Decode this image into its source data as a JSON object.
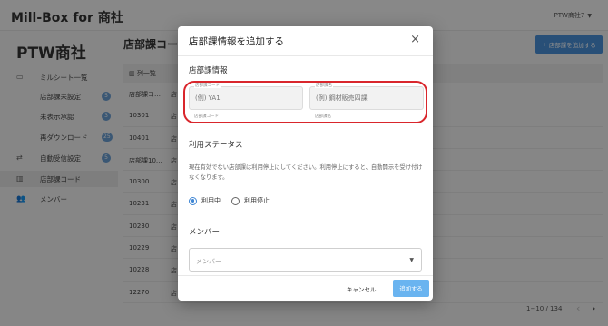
{
  "app": {
    "title": "Mill-Box for 商社",
    "user_menu": "PTW商社7"
  },
  "sidebar": {
    "company": "PTW商社",
    "items": [
      {
        "label": "ミルシート一覧",
        "icon": "inbox-icon"
      },
      {
        "label": "店部課未設定",
        "badge": "5"
      },
      {
        "label": "未表示承認",
        "badge": "3"
      },
      {
        "label": "再ダウンロード",
        "badge": "25"
      },
      {
        "label": "自動受信設定",
        "badge": "5",
        "icon": "sync-icon"
      },
      {
        "label": "店部課コード",
        "icon": "building-icon",
        "active": true
      },
      {
        "label": "メンバー",
        "icon": "people-icon"
      }
    ]
  },
  "main": {
    "title": "店部課コード",
    "add_button": "店部課を追加する",
    "column_toggle": "列一覧",
    "rows": [
      {
        "code": "店部課コ…",
        "name": "店"
      },
      {
        "code": "10301",
        "name": "店"
      },
      {
        "code": "10401",
        "name": "店"
      },
      {
        "code": "店部課10…",
        "name": "店"
      },
      {
        "code": "10300",
        "name": "店"
      },
      {
        "code": "10231",
        "name": "店"
      },
      {
        "code": "10230",
        "name": "店"
      },
      {
        "code": "10229",
        "name": "店"
      },
      {
        "code": "10228",
        "name": "店"
      },
      {
        "code": "12270",
        "name": "店"
      }
    ],
    "pager": "1−10 / 134"
  },
  "dialog": {
    "title": "店部課情報を追加する",
    "section_info": "店部課情報",
    "code_field": {
      "label": "店部課コード",
      "placeholder": "(例) YA1",
      "helper": "店部課コード"
    },
    "name_field": {
      "label": "店部課名",
      "placeholder": "(例) 鋼材販売四課",
      "helper": "店部課名"
    },
    "section_status": "利用ステータス",
    "status_desc": "現在有効でない店部課は利用停止にしてください。利用停止にすると、自動開示を受け付けなくなります。",
    "status_options": [
      "利用中",
      "利用停止"
    ],
    "status_selected": "利用中",
    "section_member": "メンバー",
    "member_placeholder": "メンバー",
    "cancel_label": "キャンセル",
    "submit_label": "追加する"
  },
  "colors": {
    "accent": "#4a90d9",
    "highlight": "#d9262c",
    "overlay": "rgba(0,0,0,0.45)"
  }
}
